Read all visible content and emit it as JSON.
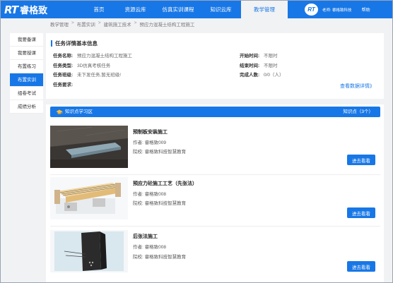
{
  "brand": {
    "logo_mark": "RT",
    "logo_text": "睿格致"
  },
  "nav": {
    "items": [
      {
        "label": "首页"
      },
      {
        "label": "资源云库"
      },
      {
        "label": "仿真实训课程"
      },
      {
        "label": "知识云库"
      },
      {
        "label": "教学管理"
      }
    ],
    "active_index": 4
  },
  "user": {
    "avatar_text": "RT",
    "name": "老师: 睿格致科技",
    "help": "帮助"
  },
  "breadcrumb": [
    "教学管理",
    "布置实训",
    "建筑施工技术",
    "预应力混凝土结构工程施工"
  ],
  "sidebar": {
    "items": [
      {
        "label": "我要备课"
      },
      {
        "label": "我要授课"
      },
      {
        "label": "布置练习"
      },
      {
        "label": "布置实训"
      },
      {
        "label": "组卷考试"
      },
      {
        "label": "成绩分析"
      }
    ],
    "active_index": 3
  },
  "task": {
    "section_title": "任务详情基本信息",
    "name_label": "任务名称:",
    "name_value": "预应力混凝土结构工程施工",
    "type_label": "任务类型:",
    "type_value": "3D仿真考核任务",
    "class_label": "任务班级:",
    "class_value": "未下发任务,暂无班级!",
    "req_label": "任务要求:",
    "req_value": "",
    "start_label": "开始时间:",
    "start_value": "不限时",
    "end_label": "结束时间:",
    "end_value": "不限时",
    "done_label": "完成人数:",
    "done_value": "0/0（人）",
    "detail_link": "查看数据详情》"
  },
  "knowledge": {
    "title": "知识点学习区",
    "count": "知识点（3个）",
    "items": [
      {
        "name": "预制板安装施工",
        "author": "作者: 睿格致009",
        "school": "院校: 睿格致科技智慧教育",
        "button": "进去看看"
      },
      {
        "name": "预应力砼施工工艺（先张法）",
        "author": "作者: 睿格致008",
        "school": "院校: 睿格致科技智慧教育",
        "button": "进去看看"
      },
      {
        "name": "后张法施工",
        "author": "作者: 睿格致008",
        "school": "院校: 睿格致科技智慧教育",
        "button": "进去看看"
      }
    ]
  },
  "colors": {
    "primary": "#1877e6",
    "background": "#f1f2f4"
  }
}
